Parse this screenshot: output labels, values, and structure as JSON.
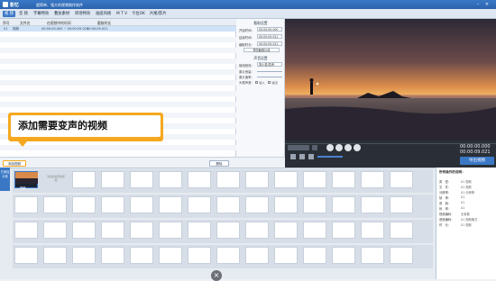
{
  "titlebar": {
    "app_name": "影忆",
    "subtitle": "超简单、强大的视频制作软件"
  },
  "menu": [
    "视 频",
    "音 频",
    "字幕特效",
    "叠加素材",
    "转场特效",
    "画面风格",
    "M T V",
    "卡拉OK",
    "片尾/影片"
  ],
  "table": {
    "headers": [
      "序号",
      "文件名",
      "在视频中的时间",
      "截取时长"
    ],
    "row": {
      "index": "01",
      "name": "视频",
      "time": "00:00:00.000 ~ 00:00:09.021",
      "duration": "00:00:09.021"
    }
  },
  "settings": {
    "section1_title": "截取设置",
    "start_label": "开始时间：",
    "start_value": "00:00:00.000",
    "end_label": "结束时间：",
    "end_value": "00:00:09.021",
    "duration_label": "截取时长：",
    "duration_value": "00:00:09.021",
    "preview_btn": "预览截取片段",
    "section2_title": "声音设置",
    "effect_label": "使用音效：",
    "effect_value": "男小男/变声",
    "volume_label": "原片音量：",
    "speed_label": "原片速率：",
    "fade_label": "头尾声音：",
    "fade_in": "淡入",
    "fade_out": "淡出",
    "ok_btn": "确认修改"
  },
  "controls": {
    "time_current": "00:00:00.000",
    "time_total": "00:00:09.021",
    "export_btn": "导出视频"
  },
  "callout": {
    "text": "添加需要变声的视频"
  },
  "tablebar": {
    "add_btn": "添加视频",
    "delete_btn": "删除"
  },
  "timeline": {
    "left_tab": "已添加片段",
    "clip_label": "视频",
    "drop_hint": "双击此处添加视频"
  },
  "info": {
    "title": "所有操作的说明：",
    "rows": [
      [
        "类　型：",
        "01 视频"
      ],
      [
        "文　件：",
        "01 视频"
      ],
      [
        "分辨率：",
        "01 分辨率"
      ],
      [
        "帧　率：",
        "01"
      ],
      [
        "音　频：",
        "01"
      ],
      [
        "码　率：",
        "01"
      ],
      [
        "视频编码：",
        "无参数"
      ],
      [
        "音频编码：",
        "01 视频格式"
      ],
      [
        "时　长：",
        "01 视频"
      ]
    ]
  }
}
